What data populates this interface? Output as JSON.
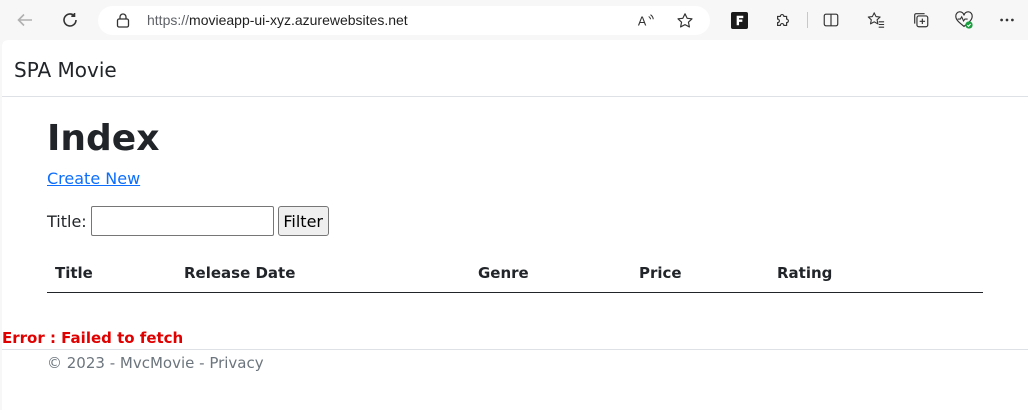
{
  "browser": {
    "url_scheme": "https://",
    "url_host": "movieapp-ui-xyz.azurewebsites.net",
    "icons": [
      "back-icon",
      "refresh-icon",
      "lock-icon",
      "read-aloud-icon",
      "favorite-star-icon",
      "extension-icon",
      "puzzle-icon",
      "split-screen-icon",
      "favorites-icon",
      "collections-icon",
      "performance-icon",
      "more-icon"
    ]
  },
  "header": {
    "brand": "SPA Movie"
  },
  "main": {
    "title": "Index",
    "create_link": "Create New",
    "filter": {
      "label": "Title:",
      "value": "",
      "button": "Filter"
    },
    "table": {
      "columns": [
        "Title",
        "Release Date",
        "Genre",
        "Price",
        "Rating"
      ]
    },
    "error": "Error : Failed to fetch"
  },
  "footer": {
    "copyright": "© 2023 - MvcMovie - ",
    "privacy_link": "Privacy"
  },
  "colors": {
    "link": "#0d6efd",
    "error": "#e00000",
    "muted": "#6c757d"
  }
}
